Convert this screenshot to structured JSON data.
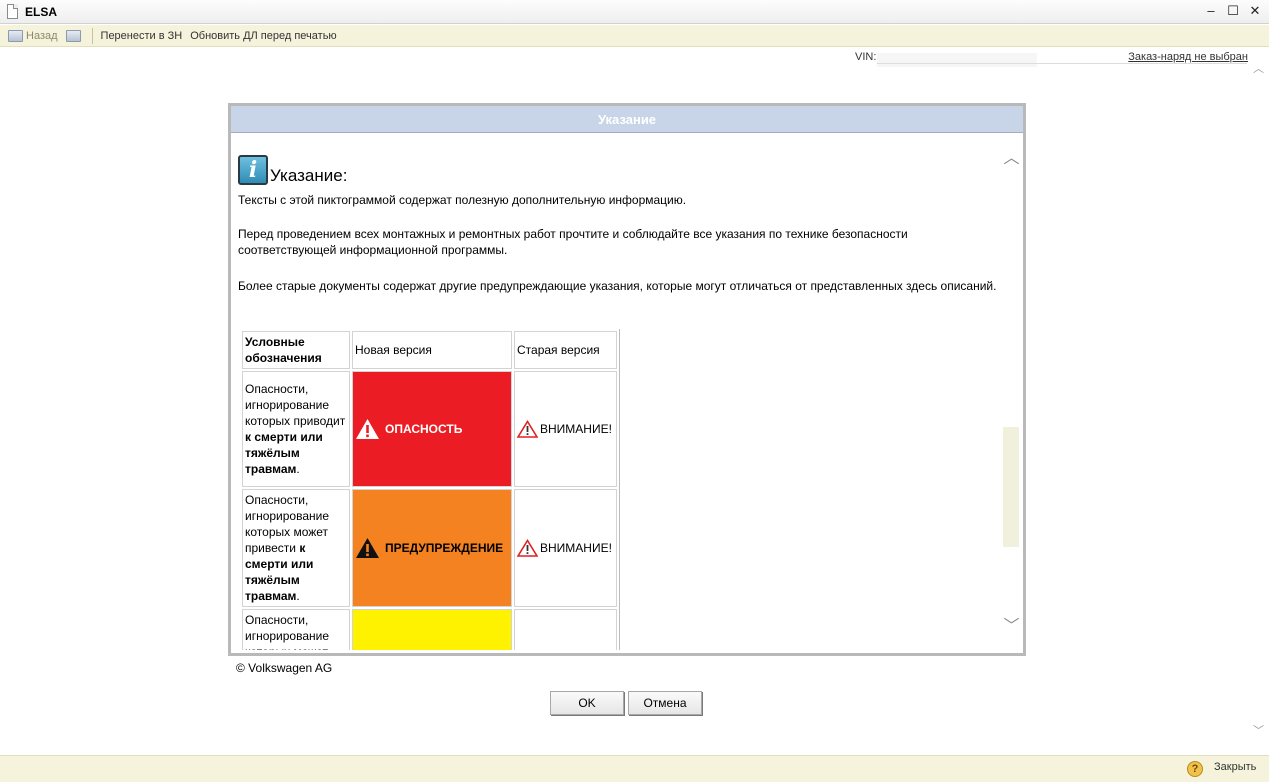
{
  "window": {
    "title": "ELSA",
    "controls": {
      "minimize": "–",
      "maximize": "☐",
      "close": "✕"
    }
  },
  "toolbar": {
    "back": "Назад",
    "transfer": "Перенести в ЗН",
    "update": "Обновить ДЛ перед печатью"
  },
  "header": {
    "vin_label": "VIN:",
    "order_link": "Заказ-наряд не выбран"
  },
  "dialog": {
    "title": "Указание",
    "info_title": "Указание:",
    "paragraph_1": "Тексты с этой пиктограммой содержат полезную дополнительную информацию.",
    "paragraph_2": "Перед проведением всех монтажных и ремонтных работ прочтите и соблюдайте все указания по технике безопасности соответствующей информационной программы.",
    "paragraph_3": "Более старые документы содержат другие предупреждающие указания, которые могут отличаться от представленных здесь описаний.",
    "table": {
      "headers": [
        "Условные обозначения",
        "Новая версия",
        "Старая версия"
      ],
      "rows": [
        {
          "desc_prefix": "Опасности, игнорирование которых приводит ",
          "desc_bold": "к смерти или тяжёлым травмам",
          "desc_suffix": ".",
          "new_label": "ОПАСНОСТЬ",
          "old_label": "ВНИМАНИЕ!"
        },
        {
          "desc_prefix": "Опасности, игнорирование которых может привести ",
          "desc_bold": "к смерти или тяжёлым травмам",
          "desc_suffix": ".",
          "new_label": "ПРЕДУПРЕЖДЕНИЕ",
          "old_label": "ВНИМАНИЕ!"
        },
        {
          "desc_prefix": "Опасности, игнорирование которых может",
          "desc_bold": "",
          "desc_suffix": "",
          "new_label": "",
          "old_label": ""
        }
      ]
    },
    "scroll_up": "︿",
    "scroll_down": "﹀"
  },
  "copyright": "© Volkswagen AG",
  "buttons": {
    "ok": "OK",
    "cancel": "Отмена"
  },
  "footer": {
    "help": "?",
    "close": "Закрыть"
  },
  "colors": {
    "danger": "#ec1c24",
    "warning": "#f58220",
    "caution": "#fff200",
    "dialog_header": "#c8d5e8"
  }
}
